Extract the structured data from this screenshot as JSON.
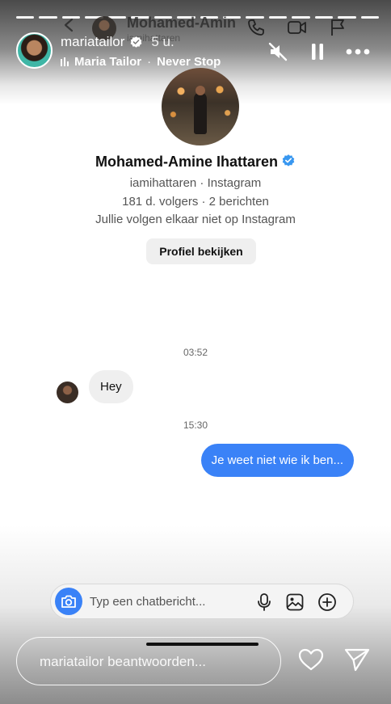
{
  "story": {
    "username": "mariatailor",
    "time": "5 u.",
    "music_artist": "Maria Tailor",
    "music_separator": "·",
    "music_title": "Never Stop"
  },
  "chat_header": {
    "name": "Mohamed-Amin",
    "handle": "iamihattaren"
  },
  "profile": {
    "name": "Mohamed-Amine Ihattaren",
    "subtitle": "iamihattaren · Instagram",
    "stats": "181 d. volgers · 2 berichten",
    "relation": "Jullie volgen elkaar niet op Instagram",
    "view_button": "Profiel bekijken"
  },
  "messages": [
    {
      "time": "03:52",
      "direction": "incoming",
      "text": "Hey"
    },
    {
      "time": "15:30",
      "direction": "outgoing",
      "text": "Je weet niet wie ik ben..."
    }
  ],
  "composer": {
    "placeholder": "Typ een chatbericht..."
  },
  "reply": {
    "placeholder": "mariatailor beantwoorden..."
  },
  "colors": {
    "accent_blue": "#3a82f7",
    "verified_blue": "#3897f0",
    "bubble_gray": "#efefef"
  },
  "icons": [
    "back-icon",
    "phone-icon",
    "video-icon",
    "flag-icon",
    "mute-icon",
    "pause-icon",
    "more-icon",
    "verified-icon",
    "camera-icon",
    "mic-icon",
    "image-icon",
    "add-icon",
    "heart-icon",
    "send-icon"
  ]
}
